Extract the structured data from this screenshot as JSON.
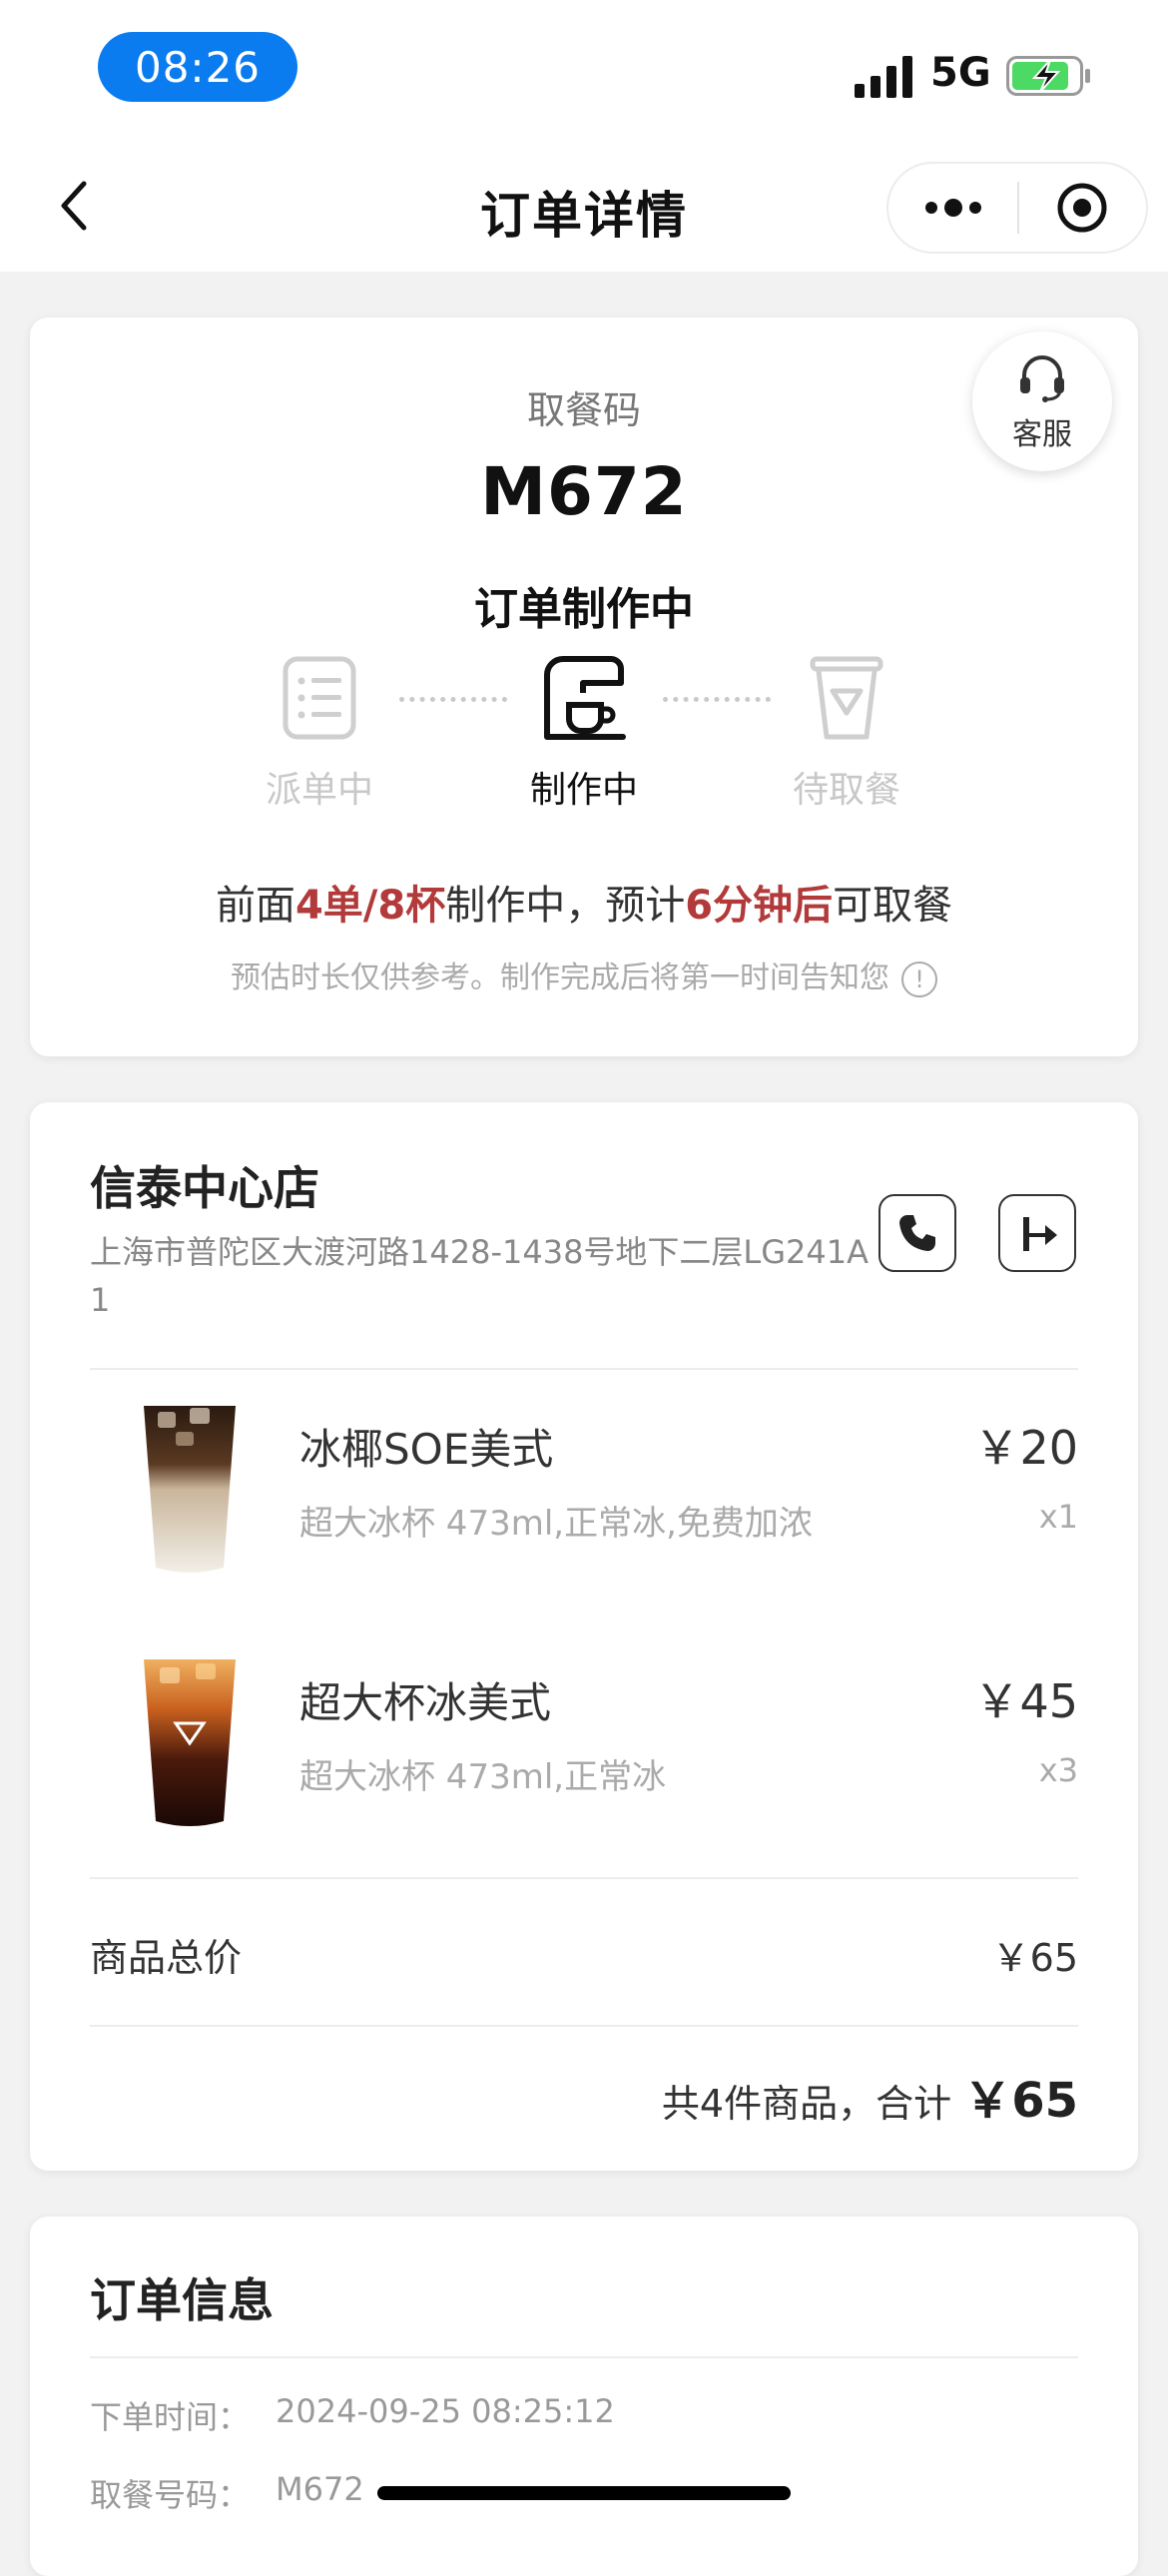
{
  "status_bar": {
    "time": "08:26",
    "network": "5G",
    "time_pill_color": "#0a7cf0",
    "battery_color": "#4cd964"
  },
  "nav": {
    "title": "订单详情"
  },
  "pickup": {
    "label": "取餐码",
    "code": "M672",
    "status": "订单制作中",
    "service_label": "客服",
    "steps": [
      {
        "label": "派单中",
        "state": "done",
        "icon": "order-list-icon"
      },
      {
        "label": "制作中",
        "state": "active",
        "icon": "coffee-machine-icon"
      },
      {
        "label": "待取餐",
        "state": "pending",
        "icon": "cup-icon"
      }
    ],
    "queue": {
      "prefix": "前面",
      "count": "4单/8杯",
      "mid": "制作中，预计",
      "eta": "6分钟后",
      "suffix": "可取餐"
    },
    "disclaimer": "预估时长仅供参考。制作完成后将第一时间告知您",
    "highlight_color": "#b23a3a"
  },
  "store": {
    "name": "信泰中心店",
    "address": "上海市普陀区大渡河路1428-1438号地下二层LG241A1",
    "items": [
      {
        "name": "冰椰SOE美式",
        "options": "超大冰杯 473ml,正常冰,免费加浓",
        "price": "￥20",
        "qty": "x1"
      },
      {
        "name": "超大杯冰美式",
        "options": "超大冰杯 473ml,正常冰",
        "price": "￥45",
        "qty": "x3"
      }
    ],
    "subtotal_label": "商品总价",
    "subtotal_value": "￥65",
    "total_prefix": "共4件商品，合计",
    "total_value": "￥65"
  },
  "order_info": {
    "title": "订单信息",
    "rows": [
      {
        "label": "下单时间：",
        "value": "2024-09-25 08:25:12"
      },
      {
        "label": "取餐号码：",
        "value": "M672"
      }
    ]
  }
}
